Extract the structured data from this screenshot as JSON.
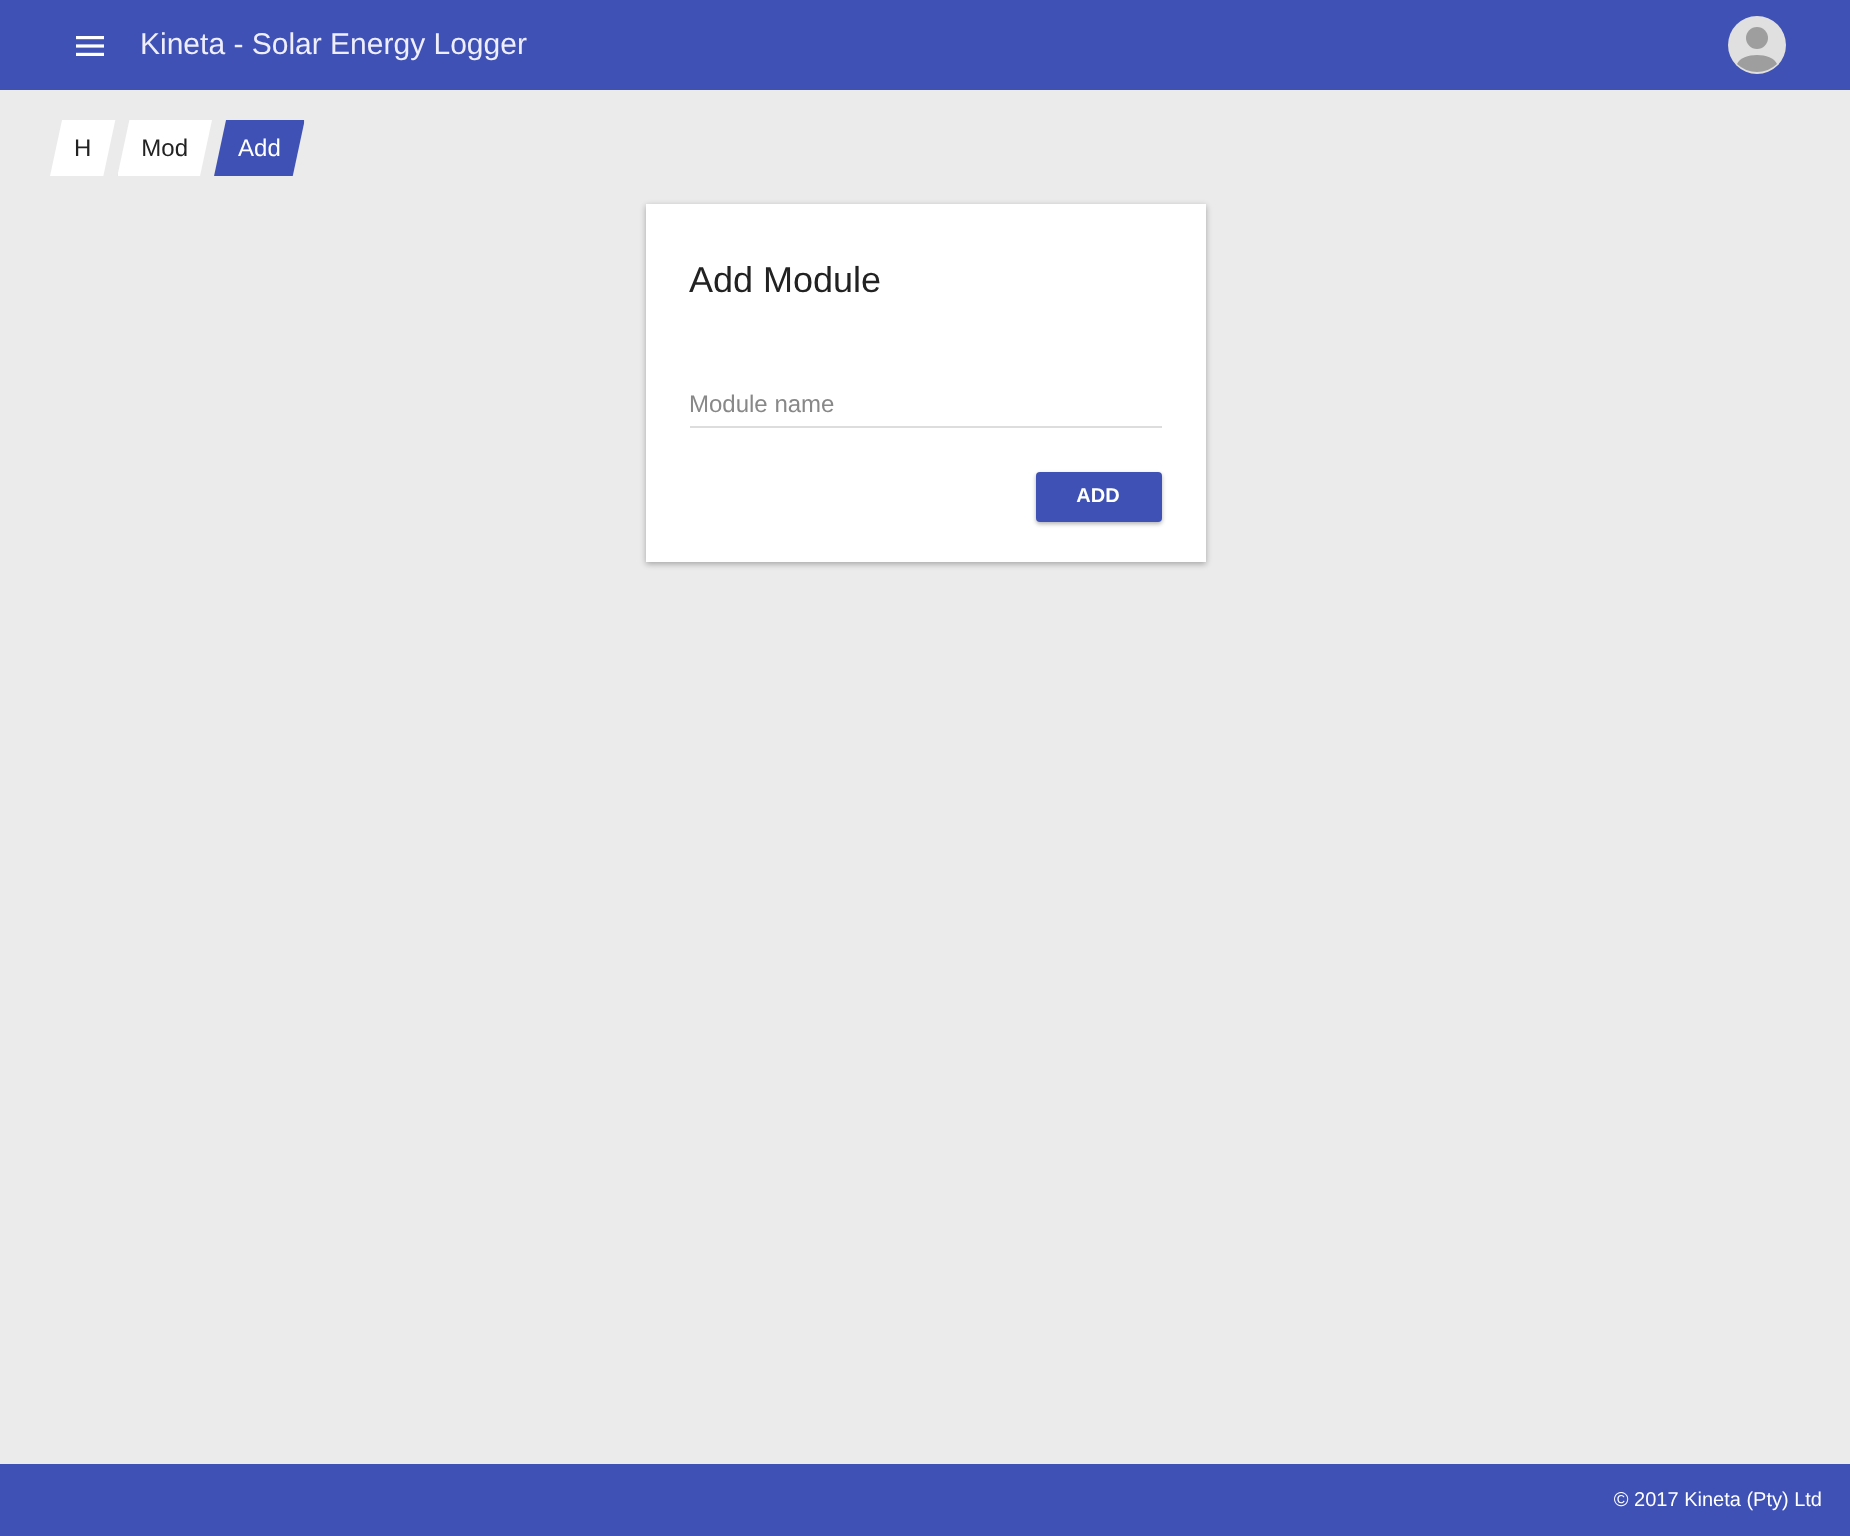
{
  "app_bar": {
    "title": "Kineta - Solar Energy Logger"
  },
  "breadcrumbs": [
    {
      "label": "H",
      "selected": false
    },
    {
      "label": "Mod",
      "selected": false
    },
    {
      "label": "Add",
      "selected": true
    }
  ],
  "card": {
    "title": "Add Module",
    "field": {
      "placeholder": "Module name"
    },
    "button": "ADD"
  },
  "footer": {
    "text": "© 2017 Kineta (Pty) Ltd"
  }
}
